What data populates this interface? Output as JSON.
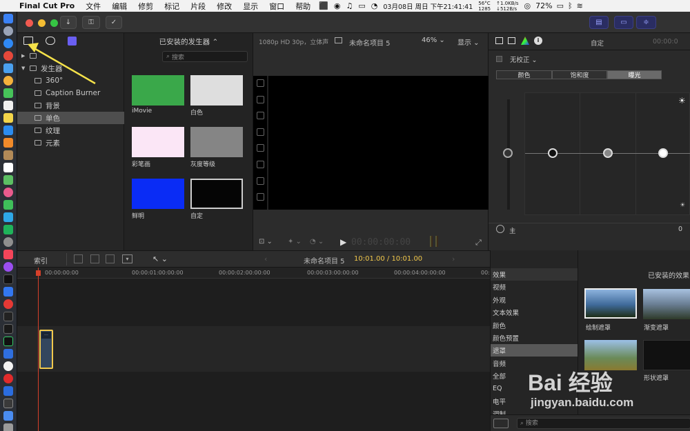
{
  "menubar": {
    "app": "Final Cut Pro",
    "items": [
      "文件",
      "编辑",
      "修剪",
      "标记",
      "片段",
      "修改",
      "显示",
      "窗口",
      "帮助"
    ],
    "temp": "56°C",
    "temp2": "1285",
    "net_up": "↑1.0KB/s",
    "net_down": "↓512B/s",
    "battery": "72%",
    "clock": "03月08日 周日 下午21:41:41"
  },
  "library": {
    "rows": [
      {
        "label": "",
        "depth": 0,
        "arrow": "▶"
      },
      {
        "label": "发生器",
        "depth": 0,
        "arrow": "▼"
      },
      {
        "label": "360°",
        "depth": 1
      },
      {
        "label": "Caption Burner",
        "depth": 1
      },
      {
        "label": "背景",
        "depth": 1
      },
      {
        "label": "单色",
        "depth": 1,
        "selected": true
      },
      {
        "label": "纹理",
        "depth": 1
      },
      {
        "label": "元素",
        "depth": 1
      }
    ]
  },
  "browser": {
    "title": "已安装的发生器",
    "search_placeholder": "搜索",
    "items": [
      {
        "label": "iMovie",
        "color": "#3aa84a"
      },
      {
        "label": "白色",
        "color": "#dedede"
      },
      {
        "label": "彩笔画",
        "color": "#fbe6f6"
      },
      {
        "label": "灰度等级",
        "color": "#858585"
      },
      {
        "label": "鲜明",
        "color": "#0a2cf5"
      },
      {
        "label": "自定",
        "color": "#050505"
      }
    ]
  },
  "viewer": {
    "format": "1080p HD 30p，立体声",
    "project": "未命名项目 5",
    "zoom": "46%",
    "view_label": "显示",
    "timecode": "00:00:00:00"
  },
  "inspector": {
    "title": "自定",
    "timecode": "00:00:0",
    "correction": "无校正",
    "tabs": [
      "颜色",
      "饱和度",
      "曝光"
    ],
    "active_tab": "曝光",
    "master_label": "主",
    "master_value": "0"
  },
  "timebar": {
    "index_label": "索引",
    "project": "未命名项目 5",
    "duration": "10:01.00 / 10:01.00",
    "ruler": [
      "00:00:00:00",
      "00:00:01:00:00:00",
      "00:00:02:00:00:00",
      "00:00:03:00:00:00",
      "00:00:04:00:00:00",
      "00:00"
    ]
  },
  "effects": {
    "title": "已安装的效果",
    "categories": [
      {
        "label": "效果",
        "hdr": true
      },
      {
        "label": "视频"
      },
      {
        "label": "外观"
      },
      {
        "label": "文本效果"
      },
      {
        "label": "颜色"
      },
      {
        "label": "颜色预置"
      },
      {
        "label": "遮罩",
        "selected": true
      },
      {
        "label": "音频"
      },
      {
        "label": "全部"
      },
      {
        "label": "EQ"
      },
      {
        "label": "电平"
      },
      {
        "label": "调制"
      }
    ],
    "items": [
      {
        "label": "绘制遮罩"
      },
      {
        "label": "渐变遮罩"
      },
      {
        "label": ""
      },
      {
        "label": "形状遮罩"
      }
    ],
    "search_placeholder": "搜索"
  },
  "watermark": {
    "brand": "Bai  经验",
    "url": "jingyan.baidu.com"
  },
  "colors": {
    "accent": "#f2c94c",
    "clip": "#33465e",
    "arrow": "#f5e24a",
    "playhead": "#d6402a"
  }
}
